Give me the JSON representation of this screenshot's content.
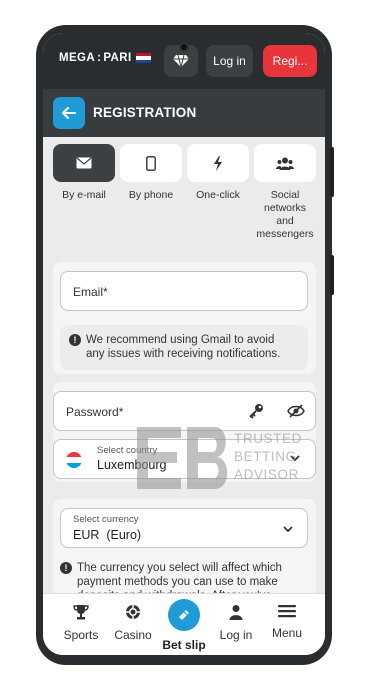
{
  "header": {
    "logo": "MEGA",
    "logo_sep": ":",
    "logo_rest": "PARI",
    "login_label": "Log in",
    "register_label": "Regi..."
  },
  "registration": {
    "title": "REGISTRATION",
    "tabs": [
      {
        "label": "By e-mail",
        "icon": "envelope-icon",
        "active": true
      },
      {
        "label": "By phone",
        "icon": "phone-icon",
        "active": false
      },
      {
        "label": "One-click",
        "icon": "lightning-icon",
        "active": false
      },
      {
        "label": "Social networks and messengers",
        "label_lines": [
          "Social",
          "networks",
          "and",
          "messengers"
        ],
        "icon": "people-icon",
        "active": false
      }
    ],
    "email": {
      "placeholder": "Email*"
    },
    "email_tip": {
      "line1": "We recommend using Gmail to avoid",
      "line2": "any issues with receiving notifications."
    },
    "password": {
      "placeholder": "Password*"
    },
    "country": {
      "label": "Select country",
      "value": "Luxembourg"
    },
    "currency": {
      "label": "Select currency",
      "value": "EUR  (Euro)"
    },
    "currency_tip": {
      "line1": "The currency you select will affect which",
      "line2": "payment methods you can use to make",
      "line3": "deposits and withdrawals. After you've"
    }
  },
  "watermark": {
    "line1": "TRUSTED",
    "line2": "BETTING",
    "line3": "ADVISOR"
  },
  "bottom_nav": [
    {
      "label": "Sports",
      "icon": "trophy-icon"
    },
    {
      "label": "Casino",
      "icon": "poker-chip-icon"
    },
    {
      "label": "Bet slip",
      "icon": "ticket-icon"
    },
    {
      "label": "Log in",
      "icon": "user-icon"
    },
    {
      "label": "Menu",
      "icon": "hamburger-icon"
    }
  ],
  "colors": {
    "accent": "#1f9cd8",
    "register": "#e8353b",
    "dark": "#2a2d2f"
  }
}
